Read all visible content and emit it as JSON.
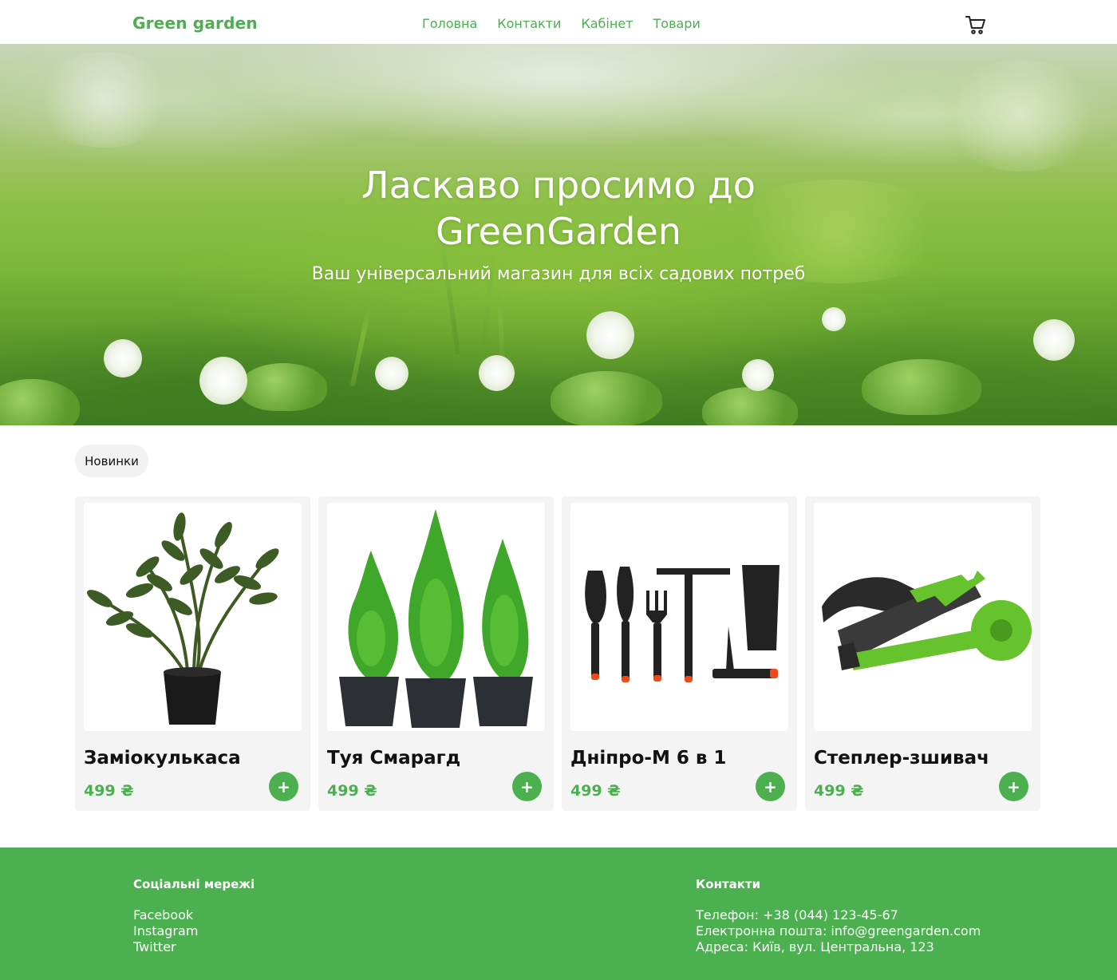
{
  "header": {
    "logo": "Green garden",
    "nav": [
      "Головна",
      "Контакти",
      "Кабінет",
      "Товари"
    ],
    "cart_icon": "cart-icon"
  },
  "hero": {
    "title_line1": "Ласкаво просимо до",
    "title_line2": "GreenGarden",
    "subtitle": "Ваш універсальний магазин для всіх садових потреб"
  },
  "section": {
    "tag": "Новинки"
  },
  "products": [
    {
      "title": "Заміокулькаса",
      "price": "499 ₴",
      "image": "zamioculcas-plant"
    },
    {
      "title": "Туя Смарагд",
      "price": "499 ₴",
      "image": "thuja-smaragd"
    },
    {
      "title": "Дніпро-М 6 в 1",
      "price": "499 ₴",
      "image": "garden-tools-set"
    },
    {
      "title": "Степлер-зшивач",
      "price": "499 ₴",
      "image": "tape-stapler"
    }
  ],
  "add_label": "+",
  "footer": {
    "social_title": "Соціальні мережі",
    "social": [
      "Facebook",
      "Instagram",
      "Twitter"
    ],
    "contacts_title": "Контакти",
    "phone": "Телефон: +38 (044) 123-45-67",
    "email": "Електронна пошта: info@greengarden.com",
    "address": "Адреса: Київ, вул. Центральна, 123"
  },
  "colors": {
    "accent": "#4caf50",
    "card_bg": "#f4f4f4"
  }
}
